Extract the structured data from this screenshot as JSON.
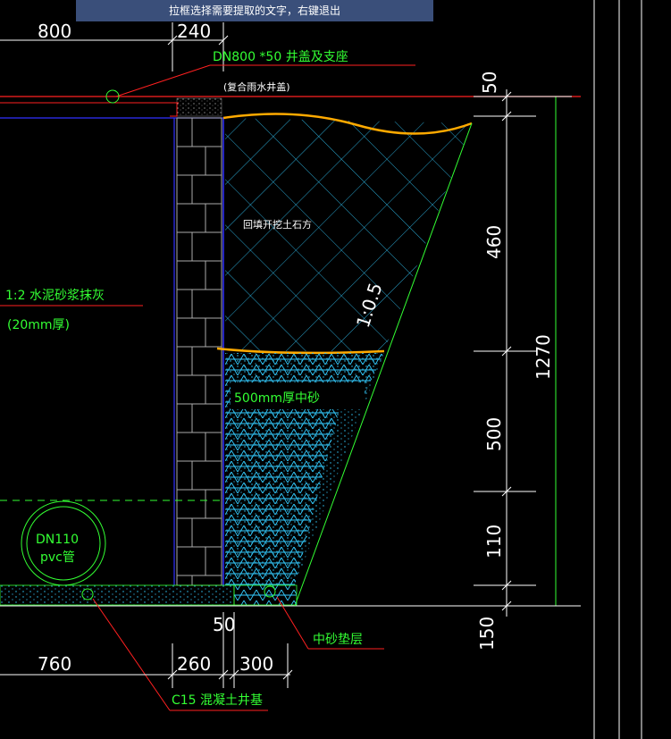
{
  "tooltip": "拉框选择需要提取的文字，右键退出",
  "dims_top": {
    "d800": "800",
    "d240": "240"
  },
  "dims_right": {
    "d50": "50",
    "d460": "460",
    "d1270": "1270",
    "d500": "500",
    "d110": "110",
    "d150": "150"
  },
  "dims_bottom": {
    "d50": "50",
    "d760": "760",
    "d260": "260",
    "d300": "300"
  },
  "labels": {
    "cover": "DN800 *50 井盖及支座",
    "cover_sub": "(复合雨水井盖)",
    "backfill": "回填开挖土石方",
    "slope": "1:0.5",
    "plaster1": "1:2 水泥砂浆抹灰",
    "plaster2": "(20mm厚)",
    "sand": "500mm厚中砂",
    "pipe1": "DN110",
    "pipe2": "pvc管",
    "cushion": "中砂垫层",
    "base": "C15 混凝土井基"
  },
  "colors": {
    "background": "#000000",
    "green": "#33ff33",
    "red": "#ff2020",
    "blue": "#3030ff",
    "cyan": "#33ccff",
    "orange": "#ffaa00",
    "white": "#ffffff"
  }
}
